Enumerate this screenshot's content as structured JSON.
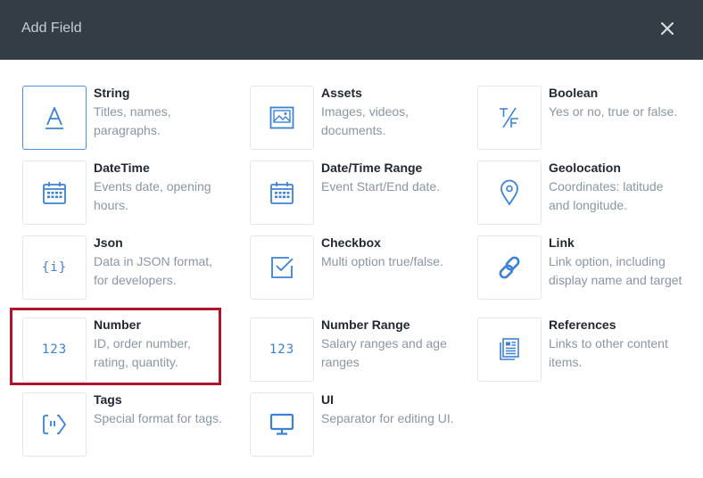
{
  "header": {
    "title": "Add Field"
  },
  "colors": {
    "accent": "#3b82d6",
    "header_bg": "#343c45",
    "highlight": "#b0152b"
  },
  "fields": [
    {
      "name": "String",
      "description": "Titles, names, paragraphs.",
      "icon": "text-a-icon"
    },
    {
      "name": "Assets",
      "description": "Images, videos, documents.",
      "icon": "image-icon"
    },
    {
      "name": "Boolean",
      "description": "Yes or no, true or false.",
      "icon": "true-false-icon",
      "icon_text": "T/F"
    },
    {
      "name": "DateTime",
      "description": "Events date, opening hours.",
      "icon": "calendar-icon"
    },
    {
      "name": "Date/Time Range",
      "description": "Event Start/End date.",
      "icon": "calendar-range-icon"
    },
    {
      "name": "Geolocation",
      "description": "Coordinates: latitude and longitude.",
      "icon": "map-pin-icon"
    },
    {
      "name": "Json",
      "description": "Data in JSON format, for developers.",
      "icon": "json-braces-icon",
      "icon_text": "{i}"
    },
    {
      "name": "Checkbox",
      "description": "Multi option true/false.",
      "icon": "checkbox-icon"
    },
    {
      "name": "Link",
      "description": "Link option, including display name and target",
      "icon": "link-icon"
    },
    {
      "name": "Number",
      "description": "ID, order number, rating, quantity.",
      "icon": "number-icon",
      "icon_text": "123"
    },
    {
      "name": "Number Range",
      "description": "Salary ranges and age ranges",
      "icon": "number-range-icon",
      "icon_text": "123"
    },
    {
      "name": "References",
      "description": "Links to other content items.",
      "icon": "references-icon"
    },
    {
      "name": "Tags",
      "description": "Special format for tags.",
      "icon": "tag-icon"
    },
    {
      "name": "UI",
      "description": "Separator for editing UI.",
      "icon": "monitor-icon"
    }
  ]
}
